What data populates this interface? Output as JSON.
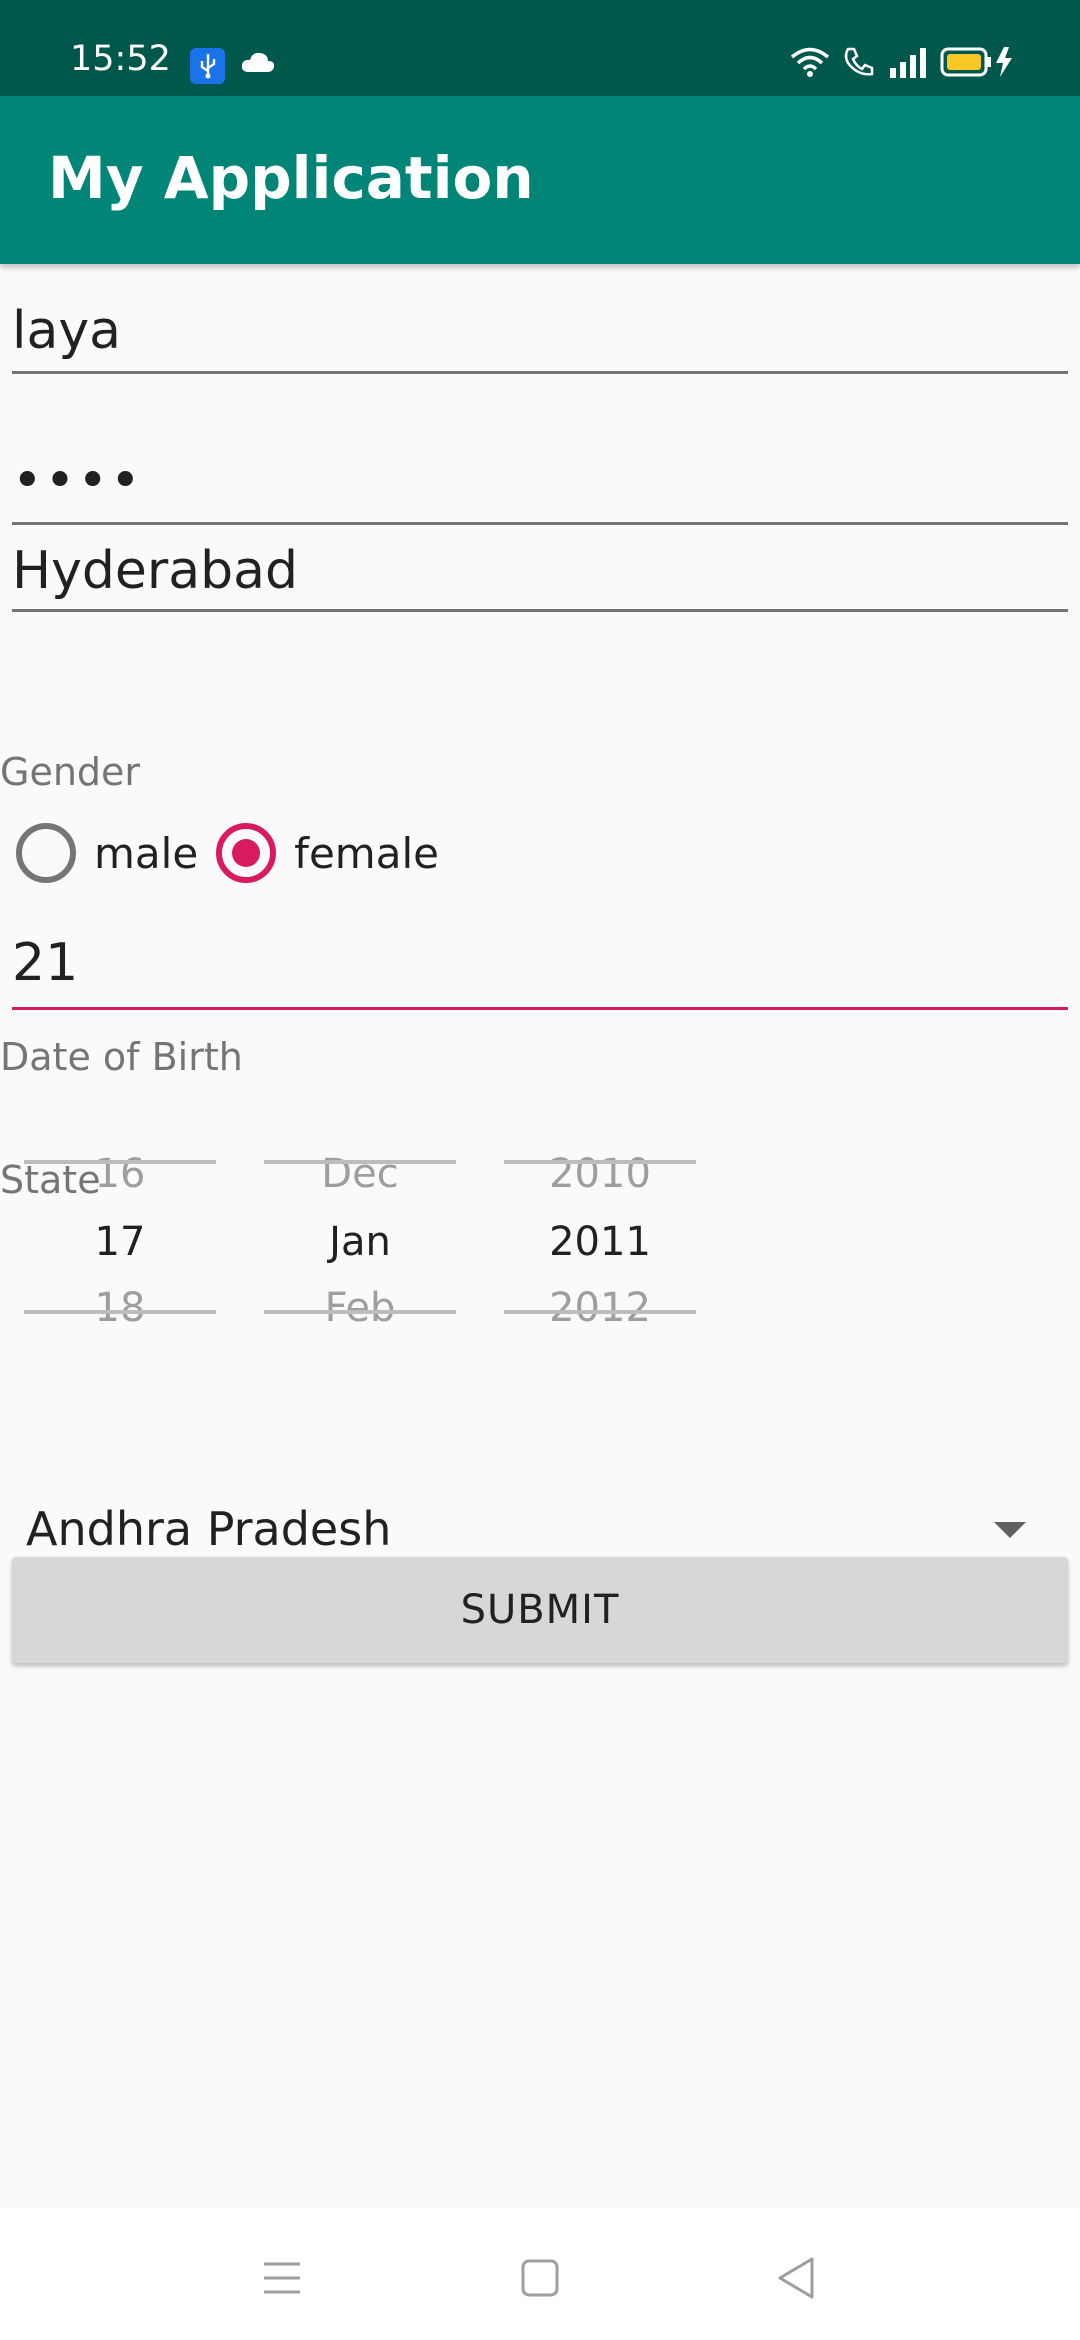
{
  "status_bar": {
    "time": "15:52",
    "icons": [
      "usb-icon",
      "cloud-icon",
      "wifi-icon",
      "volte-call-icon",
      "signal-icon",
      "battery-charging-icon"
    ]
  },
  "app_bar": {
    "title": "My Application"
  },
  "form": {
    "name_value": "laya",
    "password_value": "••••",
    "city_value": "Hyderabad",
    "gender_label": "Gender",
    "gender_options": [
      {
        "label": "male",
        "checked": false
      },
      {
        "label": "female",
        "checked": true
      }
    ],
    "age_value": "21",
    "dob_label": "Date of Birth",
    "state_label": "State",
    "date_picker": {
      "day": {
        "prev": "16",
        "selected": "17",
        "next": "18"
      },
      "month": {
        "prev": "Dec",
        "selected": "Jan",
        "next": "Feb"
      },
      "year": {
        "prev": "2010",
        "selected": "2011",
        "next": "2012"
      }
    },
    "state_value": "Andhra Pradesh",
    "submit_label": "SUBMIT"
  },
  "colors": {
    "status_bar": "#00584c",
    "app_bar": "#008577",
    "accent": "#d81b60"
  },
  "nav_bar": {
    "icons": [
      "menu-icon",
      "home-icon",
      "back-icon"
    ]
  }
}
